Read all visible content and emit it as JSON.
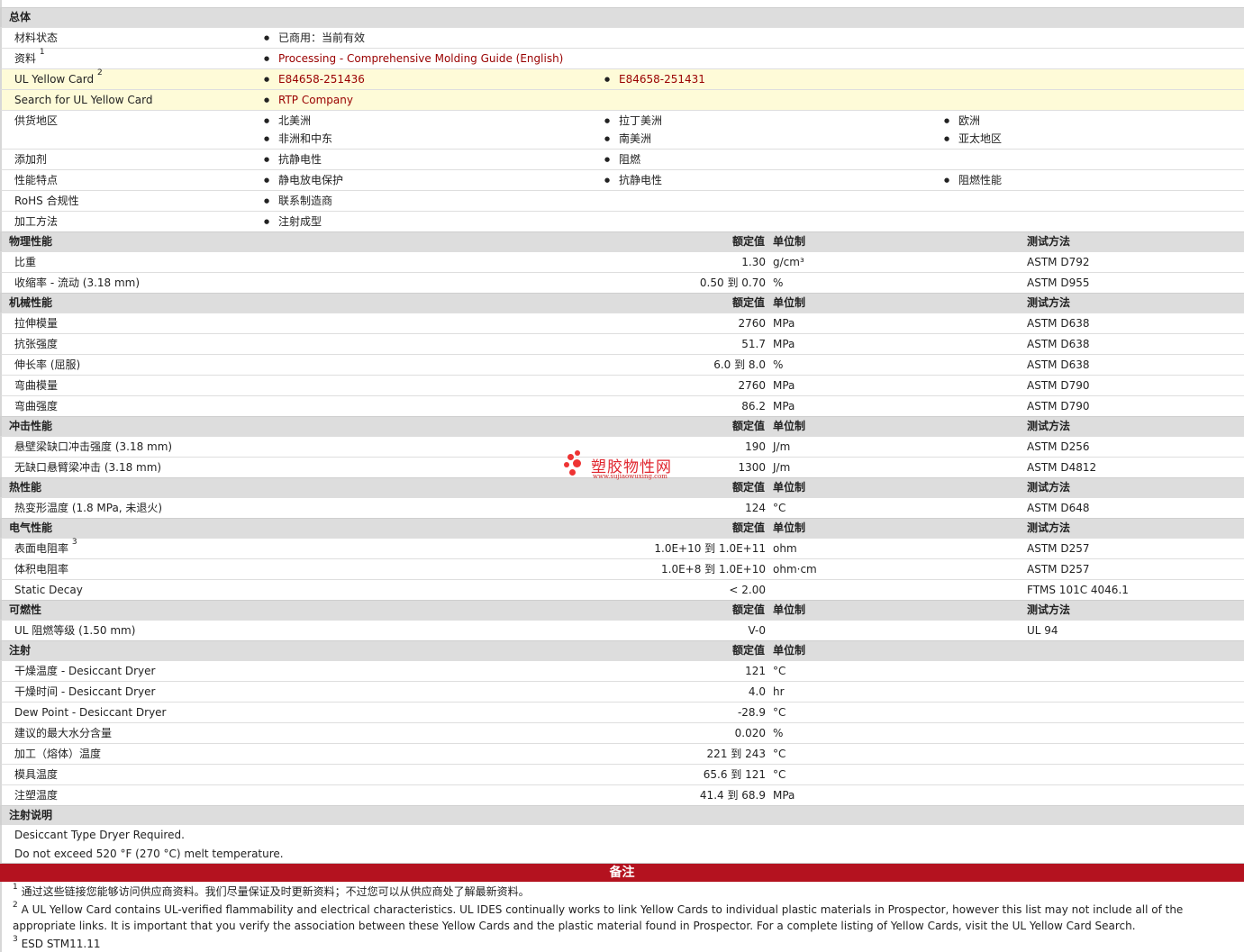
{
  "general": {
    "title": "总体",
    "rows": [
      {
        "label": "材料状态",
        "sup": "",
        "items": [
          "已商用：当前有效"
        ]
      },
      {
        "label": "资料",
        "sup": "1",
        "items": [
          "Processing - Comprehensive Molding Guide (English)"
        ],
        "link": true
      },
      {
        "label": "UL Yellow Card",
        "sup": "2",
        "items": [
          "E84658-251436",
          "E84658-251431"
        ],
        "link": true,
        "yellow": true
      },
      {
        "label": "Search for UL Yellow Card",
        "sup": "",
        "items": [
          "RTP Company"
        ],
        "link": true,
        "yellow": true
      },
      {
        "label": "供货地区",
        "sup": "",
        "items": [
          "北美洲",
          "拉丁美洲",
          "欧洲",
          "非洲和中东",
          "南美洲",
          "亚太地区"
        ],
        "tall": true
      },
      {
        "label": "添加剂",
        "sup": "",
        "items": [
          "抗静电性",
          "阻燃"
        ]
      },
      {
        "label": "性能特点",
        "sup": "",
        "items": [
          "静电放电保护",
          "抗静电性",
          "阻燃性能"
        ]
      },
      {
        "label": "RoHS 合规性",
        "sup": "",
        "items": [
          "联系制造商"
        ]
      },
      {
        "label": "加工方法",
        "sup": "",
        "items": [
          "注射成型"
        ]
      }
    ]
  },
  "col_headers": {
    "nominal": "额定值",
    "unit": "单位制",
    "method": "测试方法"
  },
  "sections": [
    {
      "title": "物理性能",
      "headers": true,
      "rows": [
        {
          "label": "比重",
          "sup": "",
          "value": "1.30",
          "unit": "g/cm³",
          "method": "ASTM D792"
        },
        {
          "label": "收缩率  - 流动  (3.18 mm)",
          "sup": "",
          "value": "0.50 到  0.70",
          "unit": "%",
          "method": "ASTM D955"
        }
      ]
    },
    {
      "title": "机械性能",
      "headers": true,
      "rows": [
        {
          "label": "拉伸模量",
          "sup": "",
          "value": "2760",
          "unit": "MPa",
          "method": "ASTM D638"
        },
        {
          "label": "抗张强度",
          "sup": "",
          "value": "51.7",
          "unit": "MPa",
          "method": "ASTM D638"
        },
        {
          "label": "伸长率  (屈服)",
          "sup": "",
          "value": "6.0 到  8.0",
          "unit": "%",
          "method": "ASTM D638"
        },
        {
          "label": "弯曲模量",
          "sup": "",
          "value": "2760",
          "unit": "MPa",
          "method": "ASTM D790"
        },
        {
          "label": "弯曲强度",
          "sup": "",
          "value": "86.2",
          "unit": "MPa",
          "method": "ASTM D790"
        }
      ]
    },
    {
      "title": "冲击性能",
      "headers": true,
      "rows": [
        {
          "label": "悬壁梁缺口冲击强度  (3.18 mm)",
          "sup": "",
          "value": "190",
          "unit": "J/m",
          "method": "ASTM D256"
        },
        {
          "label": "无缺口悬臂梁冲击  (3.18 mm)",
          "sup": "",
          "value": "1300",
          "unit": "J/m",
          "method": "ASTM D4812"
        }
      ]
    },
    {
      "title": "热性能",
      "headers": true,
      "rows": [
        {
          "label": "热变形温度  (1.8 MPa, 未退火)",
          "sup": "",
          "value": "124",
          "unit": "°C",
          "method": "ASTM D648"
        }
      ]
    },
    {
      "title": "电气性能",
      "headers": true,
      "rows": [
        {
          "label": "表面电阻率",
          "sup": "3",
          "value": "1.0E+10 到  1.0E+11",
          "unit": "ohm",
          "method": "ASTM D257"
        },
        {
          "label": "体积电阻率",
          "sup": "",
          "value": "1.0E+8 到  1.0E+10",
          "unit": "ohm·cm",
          "method": "ASTM D257"
        },
        {
          "label": "Static Decay",
          "sup": "",
          "value": "< 2.00",
          "unit": "",
          "method": "FTMS 101C 4046.1"
        }
      ]
    },
    {
      "title": "可燃性",
      "headers": true,
      "rows": [
        {
          "label": "UL 阻燃等级  (1.50 mm)",
          "sup": "",
          "value": "V-0",
          "unit": "",
          "method": "UL 94"
        }
      ]
    },
    {
      "title": "注射",
      "headers": true,
      "no_method": true,
      "rows": [
        {
          "label": "干燥温度  - Desiccant Dryer",
          "sup": "",
          "value": "121",
          "unit": "°C",
          "method": ""
        },
        {
          "label": "干燥时间  - Desiccant Dryer",
          "sup": "",
          "value": "4.0",
          "unit": "hr",
          "method": ""
        },
        {
          "label": "Dew Point - Desiccant Dryer",
          "sup": "",
          "value": "-28.9",
          "unit": "°C",
          "method": ""
        },
        {
          "label": "建议的最大水分含量",
          "sup": "",
          "value": "0.020",
          "unit": "%",
          "method": ""
        },
        {
          "label": "加工（熔体）温度",
          "sup": "",
          "value": "221 到  243",
          "unit": "°C",
          "method": ""
        },
        {
          "label": "模具温度",
          "sup": "",
          "value": "65.6 到  121",
          "unit": "°C",
          "method": ""
        },
        {
          "label": "注塑温度",
          "sup": "",
          "value": "41.4 到  68.9",
          "unit": "MPa",
          "method": ""
        }
      ]
    }
  ],
  "injection_notes": {
    "title": "注射说明",
    "lines": [
      "Desiccant Type Dryer Required.",
      "Do not exceed 520 °F (270 °C) melt temperature."
    ]
  },
  "notes": {
    "title": "备注",
    "items": [
      {
        "num": "1",
        "text": "通过这些链接您能够访问供应商资料。我们尽量保证及时更新资料；不过您可以从供应商处了解最新资料。"
      },
      {
        "num": "2",
        "text": "A UL Yellow Card contains UL-verified flammability and electrical characteristics. UL IDES continually works to link Yellow Cards to individual plastic materials in Prospector, however this list may not include all of the appropriate links. It is important that you verify the association between these Yellow Cards and the plastic material found in Prospector. For a complete listing of Yellow Cards, visit the UL Yellow Card Search."
      },
      {
        "num": "3",
        "text": "ESD STM11.11"
      }
    ]
  },
  "watermark": {
    "cn": "塑胶物性网",
    "en": "www.sujiaowuxing.com"
  },
  "colors": {
    "link": "#990000",
    "header_bg": "#dddddd",
    "yellow_row": "#fefbd8",
    "notes_bar": "#b4121f"
  }
}
